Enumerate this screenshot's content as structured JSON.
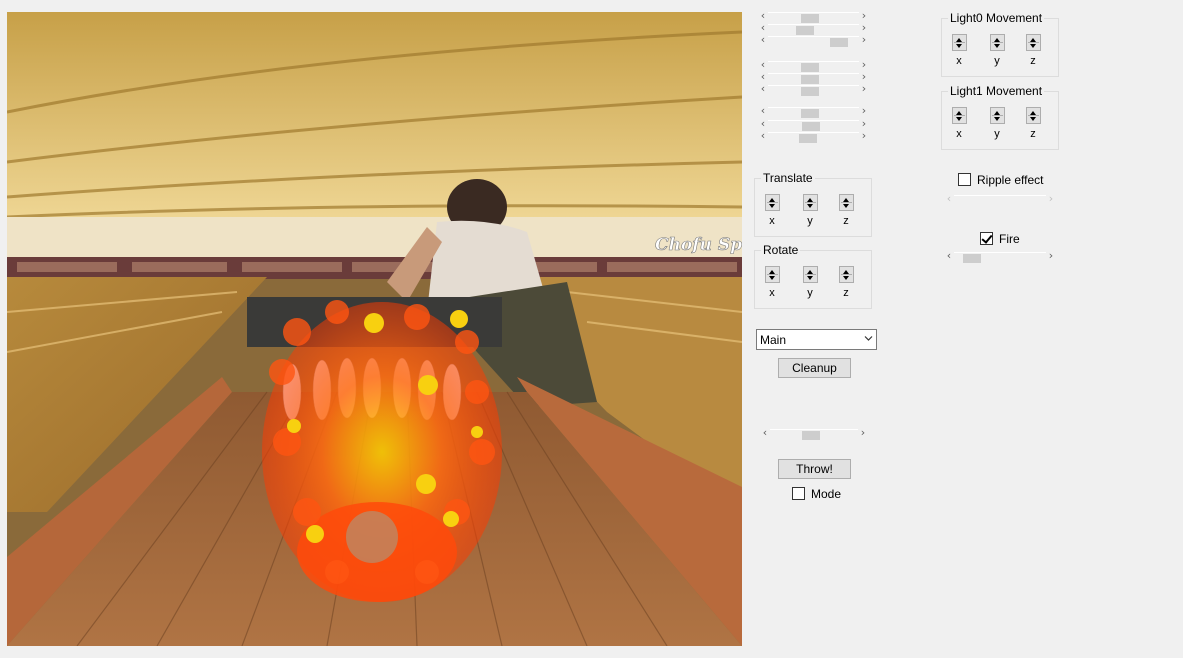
{
  "viewport": {
    "sign_text": "Chofu Spo",
    "colors": {
      "lane_wood": "#a86a3a",
      "gutter": "#b5673a",
      "fire": "#ff4a0a",
      "ceiling": "#d8b86a"
    }
  },
  "sliders_top": [
    {
      "id": "s1",
      "thumb": 0.45
    },
    {
      "id": "s2",
      "thumb": 0.38
    },
    {
      "id": "s3",
      "thumb": 0.85
    },
    {
      "id": "s4",
      "thumb": 0.45
    },
    {
      "id": "s5",
      "thumb": 0.45
    },
    {
      "id": "s6",
      "thumb": 0.45
    },
    {
      "id": "s7",
      "thumb": 0.45
    },
    {
      "id": "s8",
      "thumb": 0.47
    },
    {
      "id": "s9",
      "thumb": 0.43
    }
  ],
  "translate": {
    "title": "Translate",
    "axes": [
      "x",
      "y",
      "z"
    ]
  },
  "rotate": {
    "title": "Rotate",
    "axes": [
      "x",
      "y",
      "z"
    ]
  },
  "camera_select": {
    "value": "Main"
  },
  "cleanup_label": "Cleanup",
  "power_slider": {
    "thumb": 0.45
  },
  "throw_label": "Throw!",
  "mode": {
    "label": "Mode",
    "checked": false
  },
  "light0": {
    "title": "Light0 Movement",
    "axes": [
      "x",
      "y",
      "z"
    ]
  },
  "light1": {
    "title": "Light1 Movement",
    "axes": [
      "x",
      "y",
      "z"
    ]
  },
  "ripple": {
    "label": "Ripple effect",
    "checked": false
  },
  "fire": {
    "label": "Fire",
    "checked": true,
    "thumb": 0.12
  }
}
